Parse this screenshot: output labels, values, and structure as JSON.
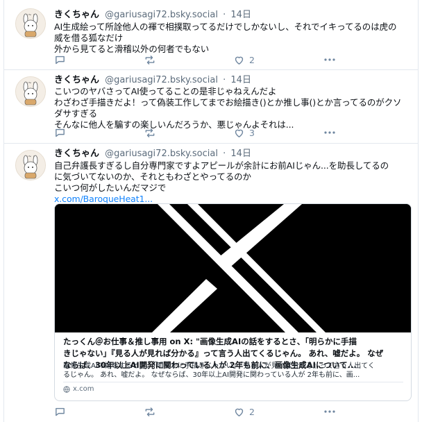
{
  "posts": [
    {
      "author": {
        "name": "きくちゃん",
        "handle": "@gariusagi72.bsky.social",
        "avatar_icon": "avatar-rabbit-illustration"
      },
      "separator": "·",
      "time": "14日",
      "lines": [
        "AI生成絵って所詮他人の褌で相撲取ってるだけでしかないし、それでイキってるのは虎の",
        "威を借る狐なだけ",
        "外から見てると滑稽以外の何者でもない"
      ],
      "actions": {
        "replies": "",
        "reposts": "",
        "likes": "2",
        "more_icon": "more-icon"
      }
    },
    {
      "author": {
        "name": "きくちゃん",
        "handle": "@gariusagi72.bsky.social",
        "avatar_icon": "avatar-rabbit-illustration"
      },
      "separator": "·",
      "time": "14日",
      "lines": [
        "こいつのヤバさってAI使ってることの是非じゃねえんだよ",
        "わざわざ手描きだよ！って偽装工作してまでお絵描き()とか推し事()とか言ってるのがクソ",
        "ダサすぎる",
        "そんなに他人を騙すの楽しいんだろうか、悪じゃんよそれは..."
      ],
      "actions": {
        "replies": "",
        "reposts": "",
        "likes": "3",
        "more_icon": "more-icon"
      }
    },
    {
      "author": {
        "name": "きくちゃん",
        "handle": "@gariusagi72.bsky.social",
        "avatar_icon": "avatar-rabbit-illustration"
      },
      "separator": "·",
      "time": "14日",
      "lines": [
        "自己弁護長すぎるし自分専門家ですよアピールが余計にお前AIじゃん...を助長してるの",
        "に気づいてないのか、それともわざとやってるのか",
        "こいつ何がしたいんだマジで"
      ],
      "link": "x.com/BaroqueHeat1...",
      "card": {
        "image_icon": "x-logo-icon",
        "title_lines": [
          "たっくん＠お仕事＆推し事用 on X: \"画像生成AIの話をするとさ、「明らかに手描",
          "きじゃない」『見る人が見れば分かる』って言う人出てくるじゃん。 あれ、嘘だよ。 なぜ",
          "ならば、30年以上AI開発に関わっている人が 2年も前に、画像生成AIについて..."
        ],
        "desc_lines": [
          "画像生成AIの話をするとさ、「明らかに手描きじゃない」『見る人が見れば分かる』って言う人出てく",
          "るじゃん。 あれ、嘘だよ。 なぜならば、30年以上AI開発に関わっている人が 2年も前に、画..."
        ],
        "domain": "x.com",
        "domain_icon": "globe-icon"
      },
      "actions": {
        "replies": "",
        "reposts": "",
        "likes": "2",
        "more_icon": "more-icon"
      }
    }
  ],
  "colors": {
    "text": "#0b0f14",
    "muted": "#5b6b7b",
    "icon": "#6f869f",
    "link": "#1083fe",
    "divider": "#e3e8ee"
  }
}
